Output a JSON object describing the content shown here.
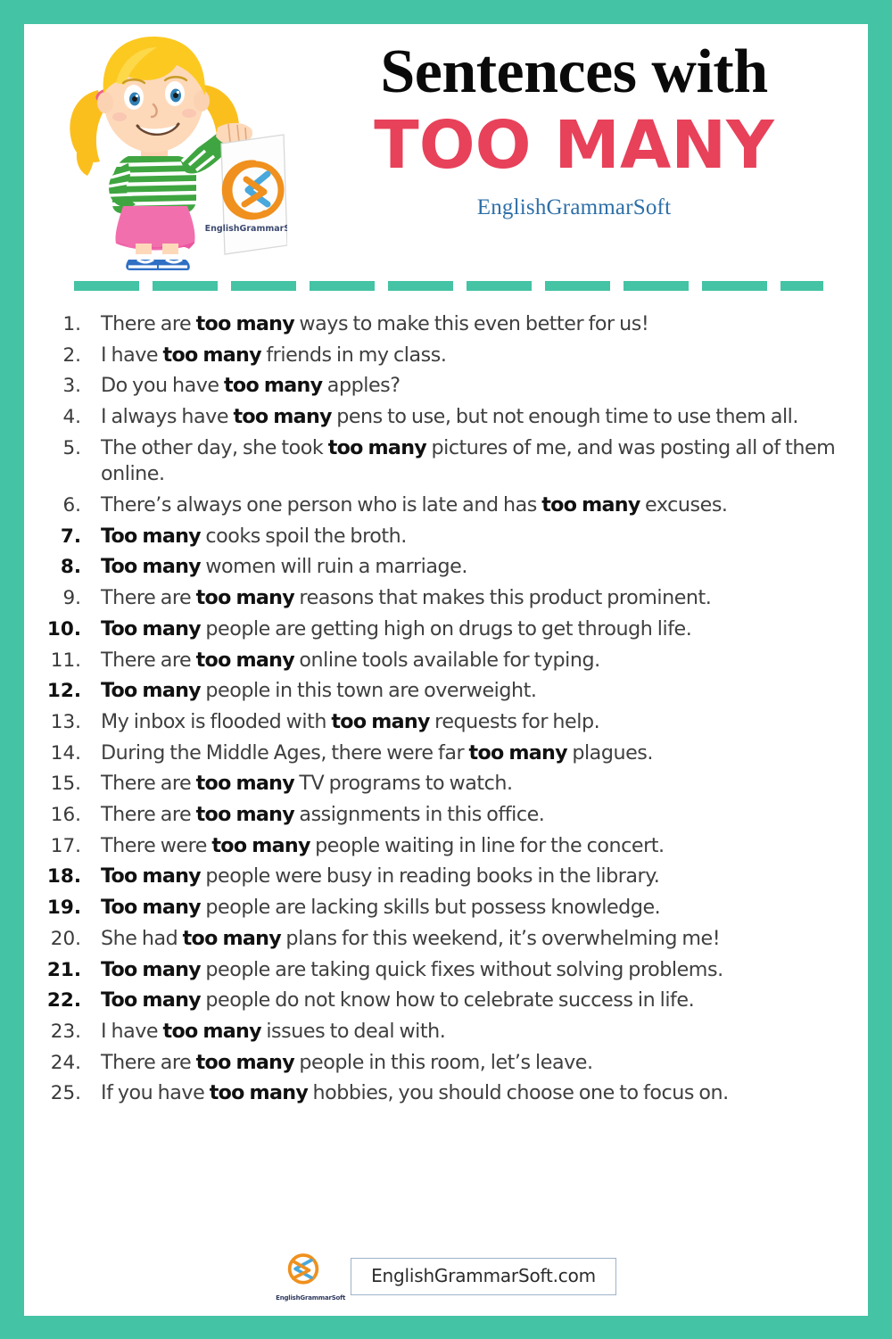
{
  "theme": {
    "border_color": "#45c3a5",
    "accent_red": "#e8415a",
    "subtitle_blue": "#2d6fa8",
    "panel_background": "#ffffff",
    "text_color": "#3f3f3f"
  },
  "header": {
    "title_line1": "Sentences with",
    "title_line2": "TOO MANY",
    "subtitle": "EnglishGrammarSoft",
    "mascot_sign_caption": "EnglishGrammarSoft"
  },
  "divider": {
    "dash_count": 10
  },
  "list": {
    "items": [
      {
        "number": "1.",
        "bold_number": false,
        "pre": "There are ",
        "bold": "too many",
        "post": " ways to make this even better for us!"
      },
      {
        "number": "2.",
        "bold_number": false,
        "pre": "I have ",
        "bold": "too many",
        "post": " friends in my class."
      },
      {
        "number": "3.",
        "bold_number": false,
        "pre": "Do you have ",
        "bold": "too many",
        "post": " apples?"
      },
      {
        "number": "4.",
        "bold_number": false,
        "pre": "I always have ",
        "bold": "too many",
        "post": " pens to use, but not enough time to use them all."
      },
      {
        "number": "5.",
        "bold_number": false,
        "pre": "The other day, she took ",
        "bold": "too many",
        "post": " pictures of me, and was posting all of them online."
      },
      {
        "number": "6.",
        "bold_number": false,
        "pre": "There’s always one person who is late and has ",
        "bold": "too many",
        "post": " excuses."
      },
      {
        "number": "7.",
        "bold_number": true,
        "pre": "",
        "bold": "Too many",
        "post": " cooks spoil the broth."
      },
      {
        "number": "8.",
        "bold_number": true,
        "pre": "",
        "bold": "Too many",
        "post": " women will ruin a marriage."
      },
      {
        "number": "9.",
        "bold_number": false,
        "pre": "There are ",
        "bold": "too many",
        "post": " reasons that makes this product prominent."
      },
      {
        "number": "10.",
        "bold_number": true,
        "pre": "",
        "bold": "Too many",
        "post": " people are getting high on drugs to get through life."
      },
      {
        "number": "11.",
        "bold_number": false,
        "pre": "There are ",
        "bold": "too many",
        "post": " online tools available for typing."
      },
      {
        "number": "12.",
        "bold_number": true,
        "pre": "",
        "bold": "Too many",
        "post": " people in this town are overweight."
      },
      {
        "number": "13.",
        "bold_number": false,
        "pre": "My inbox is flooded with ",
        "bold": "too many",
        "post": " requests for help."
      },
      {
        "number": "14.",
        "bold_number": false,
        "pre": "During the Middle Ages, there were far ",
        "bold": "too many",
        "post": " plagues."
      },
      {
        "number": "15.",
        "bold_number": false,
        "pre": "There are ",
        "bold": "too many",
        "post": " TV programs to watch."
      },
      {
        "number": "16.",
        "bold_number": false,
        "pre": "There are ",
        "bold": "too many",
        "post": " assignments in this office."
      },
      {
        "number": "17.",
        "bold_number": false,
        "pre": "There were ",
        "bold": "too many",
        "post": " people waiting in line for the concert."
      },
      {
        "number": "18.",
        "bold_number": true,
        "pre": "",
        "bold": "Too many",
        "post": " people were busy in reading books in the library."
      },
      {
        "number": "19.",
        "bold_number": true,
        "pre": "",
        "bold": "Too many",
        "post": " people are lacking skills but possess knowledge."
      },
      {
        "number": "20.",
        "bold_number": false,
        "pre": "She had ",
        "bold": "too many",
        "post": " plans for this weekend, it’s overwhelming me!"
      },
      {
        "number": "21.",
        "bold_number": true,
        "pre": "",
        "bold": "Too many",
        "post": " people are taking quick fixes without solving problems."
      },
      {
        "number": "22.",
        "bold_number": true,
        "pre": "",
        "bold": "Too many",
        "post": " people do not know how to celebrate success in life."
      },
      {
        "number": "23.",
        "bold_number": false,
        "pre": "I have ",
        "bold": "too many",
        "post": " issues to deal with."
      },
      {
        "number": "24.",
        "bold_number": false,
        "pre": "There are ",
        "bold": "too many",
        "post": " people in this room, let’s leave."
      },
      {
        "number": "25.",
        "bold_number": false,
        "pre": "If you have ",
        "bold": "too many",
        "post": " hobbies, you should choose one to focus on."
      }
    ]
  },
  "footer": {
    "logo_caption": "EnglishGrammarSoft",
    "url": "EnglishGrammarSoft.com"
  }
}
